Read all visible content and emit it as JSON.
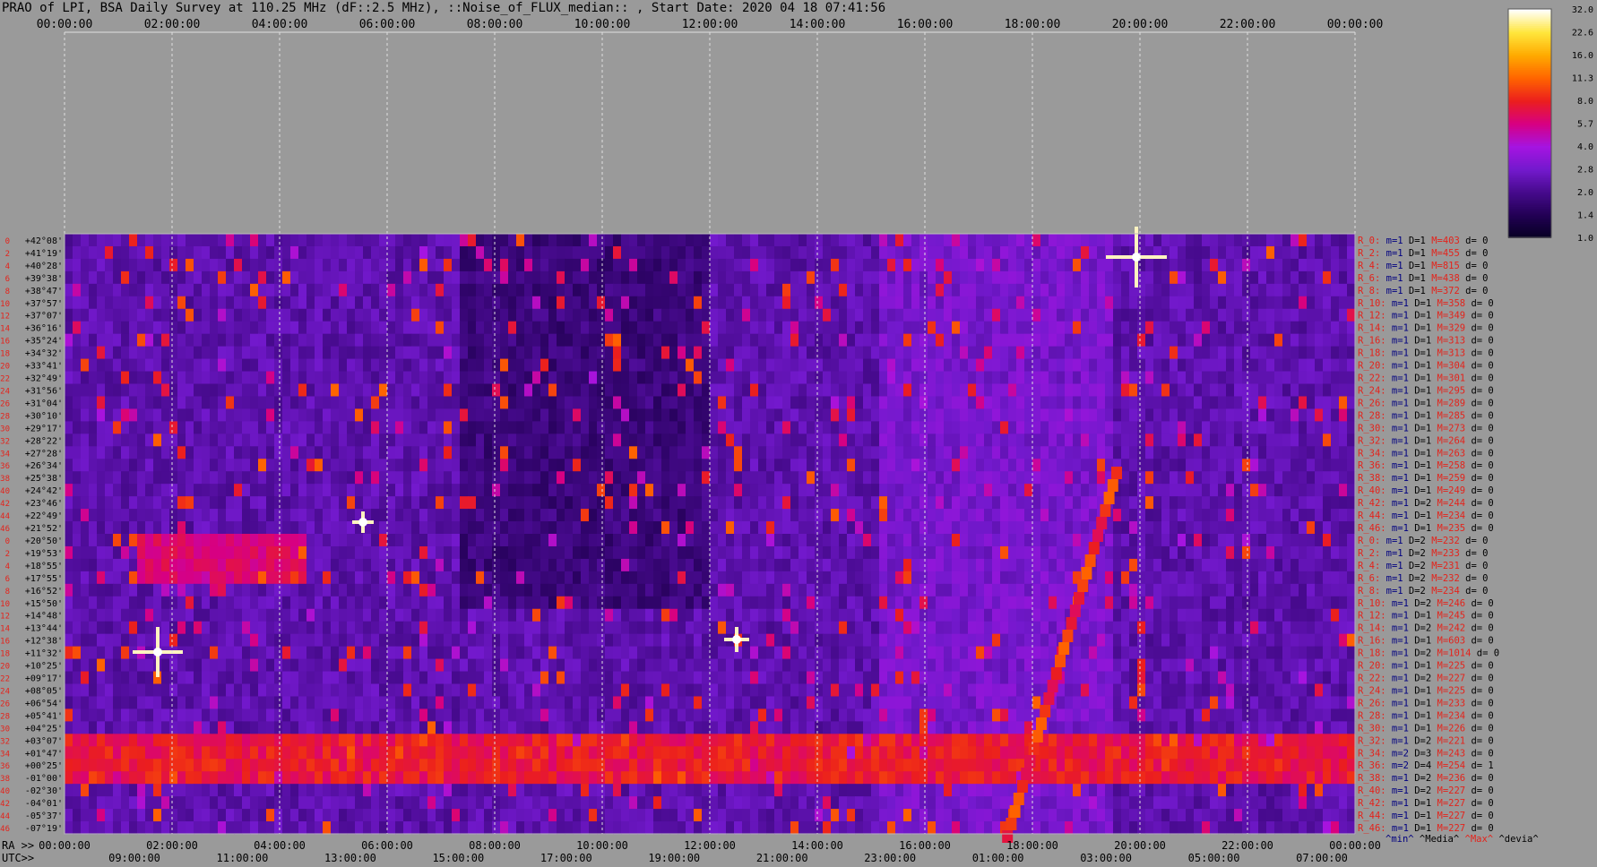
{
  "title": "PRAO of LPI, BSA Daily Survey at 110.25 MHz (dF::2.5 MHz), ::Noise_of_FLUX_median:: , Start Date: 2020 04 18 07:41:56",
  "chart_data": {
    "type": "heatmap",
    "title": "PRAO of LPI, BSA Daily Survey at 110.25 MHz (dF::2.5 MHz), ::Noise_of_FLUX_median:: , Start Date: 2020 04 18 07:41:56",
    "x_top_ticks": [
      "00:00:00",
      "02:00:00",
      "04:00:00",
      "06:00:00",
      "08:00:00",
      "10:00:00",
      "12:00:00",
      "14:00:00",
      "16:00:00",
      "18:00:00",
      "20:00:00",
      "22:00:00",
      "00:00:00"
    ],
    "ra_label": "RA >>",
    "ra_ticks": [
      "00:00:00",
      "02:00:00",
      "04:00:00",
      "06:00:00",
      "08:00:00",
      "10:00:00",
      "12:00:00",
      "14:00:00",
      "16:00:00",
      "18:00:00",
      "20:00:00",
      "22:00:00",
      "00:00:00"
    ],
    "utc_label": "UTC>>",
    "utc_ticks": [
      "09:00:00",
      "11:00:00",
      "13:00:00",
      "15:00:00",
      "17:00:00",
      "19:00:00",
      "21:00:00",
      "23:00:00",
      "01:00:00",
      "03:00:00",
      "05:00:00",
      "07:00:00"
    ],
    "declinations": [
      "+42°08'",
      "+41°19'",
      "+40°28'",
      "+39°38'",
      "+38°47'",
      "+37°57'",
      "+37°07'",
      "+36°16'",
      "+35°24'",
      "+34°32'",
      "+33°41'",
      "+32°49'",
      "+31°56'",
      "+31°04'",
      "+30°10'",
      "+29°17'",
      "+28°22'",
      "+27°28'",
      "+26°34'",
      "+25°38'",
      "+24°42'",
      "+23°46'",
      "+22°49'",
      "+21°52'",
      "+20°50'",
      "+19°53'",
      "+18°55'",
      "+17°55'",
      "+16°52'",
      "+15°50'",
      "+14°48'",
      "+13°44'",
      "+12°38'",
      "+11°32'",
      "+10°25'",
      "+09°17'",
      "+08°05'",
      "+06°54'",
      "+05°41'",
      "+04°25'",
      "+03°07'",
      "+01°47'",
      "+00°25'",
      "-01°00'",
      "-02°30'",
      "-04°01'",
      "-05°37'",
      "-07°19'"
    ],
    "row_numbers": [
      "0",
      "2",
      "4",
      "6",
      "8",
      "10",
      "12",
      "14",
      "16",
      "18",
      "20",
      "22",
      "24",
      "26",
      "28",
      "30",
      "32",
      "34",
      "36",
      "38",
      "40",
      "42",
      "44",
      "46",
      "0",
      "2",
      "4",
      "6",
      "8",
      "10",
      "12",
      "14",
      "16",
      "18",
      "20",
      "22",
      "24",
      "26",
      "28",
      "30",
      "32",
      "34",
      "36",
      "38",
      "40",
      "42",
      "44",
      "46"
    ],
    "colorbar": {
      "ticks": [
        "32.0",
        "22.6",
        "16.0",
        "11.3",
        "8.0",
        "5.7",
        "4.0",
        "2.8",
        "2.0",
        "1.4",
        "1.0"
      ],
      "scale": "log"
    },
    "row_stats": [
      {
        "r": "R_0:",
        "m": "m=1",
        "d": "D=1",
        "mx": "M=403",
        "dv": "d= 0"
      },
      {
        "r": "R_2:",
        "m": "m=1",
        "d": "D=1",
        "mx": "M=455",
        "dv": "d= 0"
      },
      {
        "r": "R_4:",
        "m": "m=1",
        "d": "D=1",
        "mx": "M=815",
        "dv": "d= 0"
      },
      {
        "r": "R_6:",
        "m": "m=1",
        "d": "D=1",
        "mx": "M=438",
        "dv": "d= 0"
      },
      {
        "r": "R_8:",
        "m": "m=1",
        "d": "D=1",
        "mx": "M=372",
        "dv": "d= 0"
      },
      {
        "r": "R_10:",
        "m": "m=1",
        "d": "D=1",
        "mx": "M=358",
        "dv": "d= 0"
      },
      {
        "r": "R_12:",
        "m": "m=1",
        "d": "D=1",
        "mx": "M=349",
        "dv": "d= 0"
      },
      {
        "r": "R_14:",
        "m": "m=1",
        "d": "D=1",
        "mx": "M=329",
        "dv": "d= 0"
      },
      {
        "r": "R_16:",
        "m": "m=1",
        "d": "D=1",
        "mx": "M=313",
        "dv": "d= 0"
      },
      {
        "r": "R_18:",
        "m": "m=1",
        "d": "D=1",
        "mx": "M=313",
        "dv": "d= 0"
      },
      {
        "r": "R_20:",
        "m": "m=1",
        "d": "D=1",
        "mx": "M=304",
        "dv": "d= 0"
      },
      {
        "r": "R_22:",
        "m": "m=1",
        "d": "D=1",
        "mx": "M=301",
        "dv": "d= 0"
      },
      {
        "r": "R_24:",
        "m": "m=1",
        "d": "D=1",
        "mx": "M=295",
        "dv": "d= 0"
      },
      {
        "r": "R_26:",
        "m": "m=1",
        "d": "D=1",
        "mx": "M=289",
        "dv": "d= 0"
      },
      {
        "r": "R_28:",
        "m": "m=1",
        "d": "D=1",
        "mx": "M=285",
        "dv": "d= 0"
      },
      {
        "r": "R_30:",
        "m": "m=1",
        "d": "D=1",
        "mx": "M=273",
        "dv": "d= 0"
      },
      {
        "r": "R_32:",
        "m": "m=1",
        "d": "D=1",
        "mx": "M=264",
        "dv": "d= 0"
      },
      {
        "r": "R_34:",
        "m": "m=1",
        "d": "D=1",
        "mx": "M=263",
        "dv": "d= 0"
      },
      {
        "r": "R_36:",
        "m": "m=1",
        "d": "D=1",
        "mx": "M=258",
        "dv": "d= 0"
      },
      {
        "r": "R_38:",
        "m": "m=1",
        "d": "D=1",
        "mx": "M=259",
        "dv": "d= 0"
      },
      {
        "r": "R_40:",
        "m": "m=1",
        "d": "D=1",
        "mx": "M=249",
        "dv": "d= 0"
      },
      {
        "r": "R_42:",
        "m": "m=1",
        "d": "D=2",
        "mx": "M=244",
        "dv": "d= 0"
      },
      {
        "r": "R_44:",
        "m": "m=1",
        "d": "D=1",
        "mx": "M=234",
        "dv": "d= 0"
      },
      {
        "r": "R_46:",
        "m": "m=1",
        "d": "D=1",
        "mx": "M=235",
        "dv": "d= 0"
      },
      {
        "r": "R_0:",
        "m": "m=1",
        "d": "D=2",
        "mx": "M=232",
        "dv": "d= 0"
      },
      {
        "r": "R_2:",
        "m": "m=1",
        "d": "D=2",
        "mx": "M=233",
        "dv": "d= 0"
      },
      {
        "r": "R_4:",
        "m": "m=1",
        "d": "D=2",
        "mx": "M=231",
        "dv": "d= 0"
      },
      {
        "r": "R_6:",
        "m": "m=1",
        "d": "D=2",
        "mx": "M=232",
        "dv": "d= 0"
      },
      {
        "r": "R_8:",
        "m": "m=1",
        "d": "D=2",
        "mx": "M=234",
        "dv": "d= 0"
      },
      {
        "r": "R_10:",
        "m": "m=1",
        "d": "D=2",
        "mx": "M=246",
        "dv": "d= 0"
      },
      {
        "r": "R_12:",
        "m": "m=1",
        "d": "D=1",
        "mx": "M=245",
        "dv": "d= 0"
      },
      {
        "r": "R_14:",
        "m": "m=1",
        "d": "D=2",
        "mx": "M=242",
        "dv": "d= 0"
      },
      {
        "r": "R_16:",
        "m": "m=1",
        "d": "D=1",
        "mx": "M=603",
        "dv": "d= 0"
      },
      {
        "r": "R_18:",
        "m": "m=1",
        "d": "D=2",
        "mx": "M=1014",
        "dv": "d= 0"
      },
      {
        "r": "R_20:",
        "m": "m=1",
        "d": "D=1",
        "mx": "M=225",
        "dv": "d= 0"
      },
      {
        "r": "R_22:",
        "m": "m=1",
        "d": "D=2",
        "mx": "M=227",
        "dv": "d= 0"
      },
      {
        "r": "R_24:",
        "m": "m=1",
        "d": "D=1",
        "mx": "M=225",
        "dv": "d= 0"
      },
      {
        "r": "R_26:",
        "m": "m=1",
        "d": "D=1",
        "mx": "M=233",
        "dv": "d= 0"
      },
      {
        "r": "R_28:",
        "m": "m=1",
        "d": "D=1",
        "mx": "M=234",
        "dv": "d= 0"
      },
      {
        "r": "R_30:",
        "m": "m=1",
        "d": "D=1",
        "mx": "M=226",
        "dv": "d= 0"
      },
      {
        "r": "R_32:",
        "m": "m=1",
        "d": "D=2",
        "mx": "M=221",
        "dv": "d= 0"
      },
      {
        "r": "R_34:",
        "m": "m=2",
        "d": "D=3",
        "mx": "M=243",
        "dv": "d= 0"
      },
      {
        "r": "R_36:",
        "m": "m=2",
        "d": "D=4",
        "mx": "M=254",
        "dv": "d= 1"
      },
      {
        "r": "R_38:",
        "m": "m=1",
        "d": "D=2",
        "mx": "M=236",
        "dv": "d= 0"
      },
      {
        "r": "R_40:",
        "m": "m=1",
        "d": "D=2",
        "mx": "M=227",
        "dv": "d= 0"
      },
      {
        "r": "R_42:",
        "m": "m=1",
        "d": "D=1",
        "mx": "M=227",
        "dv": "d= 0"
      },
      {
        "r": "R_44:",
        "m": "m=1",
        "d": "D=1",
        "mx": "M=227",
        "dv": "d= 0"
      },
      {
        "r": "R_46:",
        "m": "m=1",
        "d": "D=1",
        "mx": "M=227",
        "dv": "d= 0"
      }
    ],
    "stat_legend": [
      "^min^",
      "^Media^",
      "^Max^",
      "^devia^"
    ],
    "colors": {
      "background": "#9a9a9a",
      "label_red": "#e4231b",
      "label_navy": "#000080",
      "label_black": "#000000",
      "label_white": "#ffffff"
    }
  }
}
